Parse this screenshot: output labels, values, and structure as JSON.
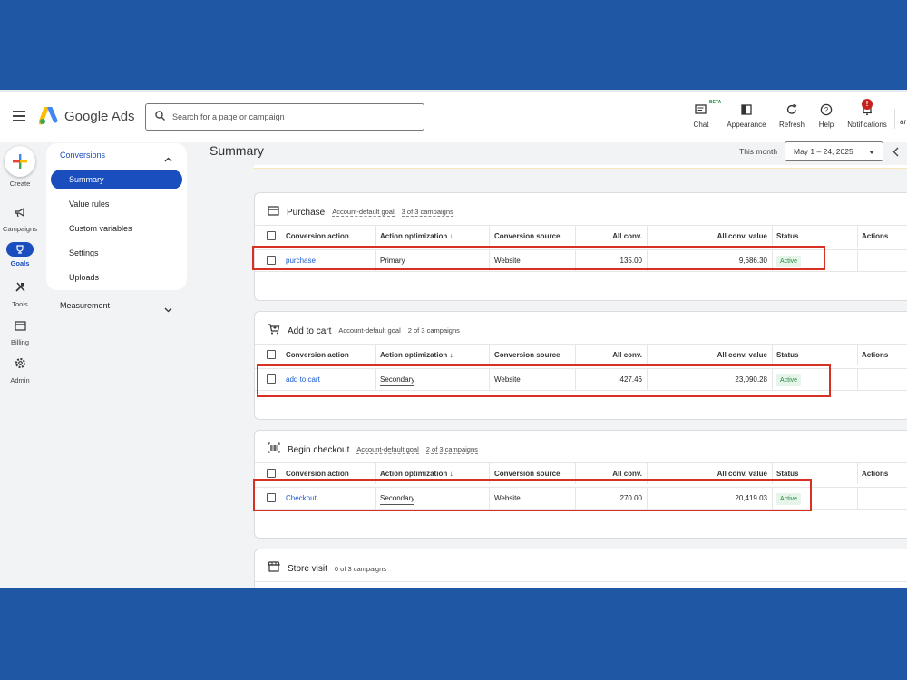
{
  "header": {
    "app_name": "Google Ads",
    "search_placeholder": "Search for a page or campaign",
    "actions": [
      {
        "label": "Chat",
        "icon": "chat-icon",
        "badge": "BETA"
      },
      {
        "label": "Appearance",
        "icon": "appearance-icon"
      },
      {
        "label": "Refresh",
        "icon": "refresh-icon"
      },
      {
        "label": "Help",
        "icon": "help-icon"
      },
      {
        "label": "Notifications",
        "icon": "bell-icon",
        "badge": "!"
      }
    ],
    "cut_label": "ar"
  },
  "nav": {
    "create": "Create",
    "campaigns": "Campaigns",
    "goals": "Goals",
    "tools": "Tools",
    "billing": "Billing",
    "admin": "Admin"
  },
  "subnav": {
    "section": "Conversions",
    "items": [
      "Summary",
      "Value rules",
      "Custom variables",
      "Settings",
      "Uploads"
    ],
    "selected": "Summary",
    "measurement": "Measurement"
  },
  "main": {
    "title": "Summary",
    "range_label": "This month",
    "range_value": "May 1 – 24, 2025"
  },
  "columns": [
    "Conversion action",
    "Action optimization",
    "Conversion source",
    "All conv.",
    "All conv. value",
    "Status",
    "Actions"
  ],
  "sort_arrow": "↓",
  "goals": [
    {
      "title": "Purchase",
      "tag": "Account-default goal",
      "campaigns": "3 of 3 campaigns",
      "row": {
        "action": "purchase",
        "optimization": "Primary",
        "source": "Website",
        "conv": "135.00",
        "value": "9,686.30",
        "status": "Active"
      }
    },
    {
      "title": "Add to cart",
      "tag": "Account-default goal",
      "campaigns": "2 of 3 campaigns",
      "row": {
        "action": "add to cart",
        "optimization": "Secondary",
        "source": "Website",
        "conv": "427.46",
        "value": "23,090.28",
        "status": "Active"
      }
    },
    {
      "title": "Begin checkout",
      "tag": "Account-default goal",
      "campaigns": "2 of 3 campaigns",
      "row": {
        "action": "Checkout",
        "optimization": "Secondary",
        "source": "Website",
        "conv": "270.00",
        "value": "20,419.03",
        "status": "Active"
      }
    },
    {
      "title": "Store visit",
      "campaigns": "0 of 3 campaigns"
    }
  ],
  "colors": {
    "accent": "#1a4ebf",
    "highlight": "#d93025",
    "active": "#1e8e3e",
    "background": "#1f57a4"
  }
}
